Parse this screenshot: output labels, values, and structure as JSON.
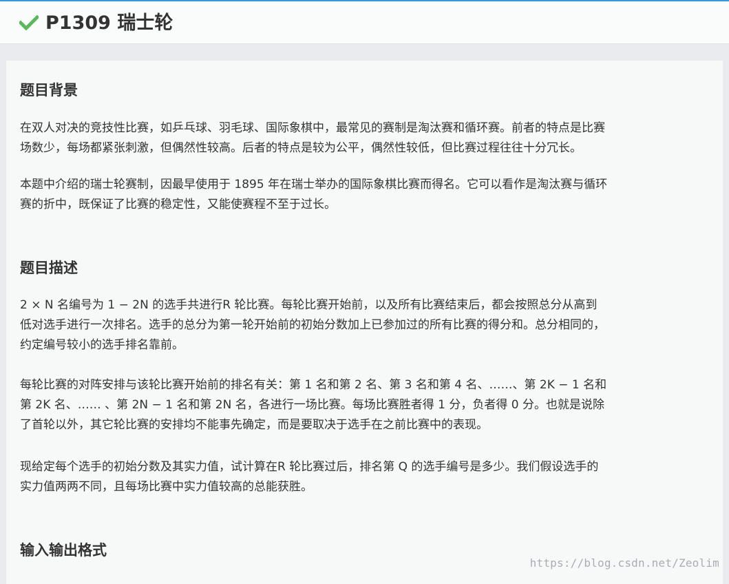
{
  "header": {
    "title": "P1309 瑞士轮",
    "status_icon": "check-icon",
    "status_color": "#5cb85c"
  },
  "sections": [
    {
      "title": "题目背景",
      "paragraphs": [
        {
          "lines": [
            "在双人对决的竞技性比赛，如乒乓球、羽毛球、国际象棋中，最常见的赛制是淘汰赛和循环赛。前者的特点是比赛",
            "场数少，每场都紧张刺激，但偶然性较高。后者的特点是较为公平，偶然性较低，但比赛过程往往十分冗长。"
          ]
        },
        {
          "lines": [
            "本题中介绍的瑞士轮赛制，因最早使用于 1895 年在瑞士举办的国际象棋比赛而得名。它可以看作是淘汰赛与循环",
            "赛的折中，既保证了比赛的稳定性，又能使赛程不至于过长。"
          ]
        }
      ]
    },
    {
      "title": "题目描述",
      "paragraphs": [
        {
          "lines": [
            "2 × N 名编号为 1 − 2N 的选手共进行R 轮比赛。每轮比赛开始前，以及所有比赛结束后，都会按照总分从高到",
            "低对选手进行一次排名。选手的总分为第一轮开始前的初始分数加上已参加过的所有比赛的得分和。总分相同的，",
            "约定编号较小的选手排名靠前。"
          ]
        },
        {
          "lines": [
            "每轮比赛的对阵安排与该轮比赛开始前的排名有关：第 1 名和第 2 名、第 3 名和第 4 名、……、第 2K − 1 名和",
            "第 2K 名、…… 、第 2N − 1 名和第 2N 名，各进行一场比赛。每场比赛胜者得 1 分，负者得 0 分。也就是说除",
            "了首轮以外，其它轮比赛的安排均不能事先确定，而是要取决于选手在之前比赛中的表现。"
          ]
        },
        {
          "lines": [
            "现给定每个选手的初始分数及其实力值，试计算在R 轮比赛过后，排名第 Q 的选手编号是多少。我们假设选手的",
            "实力值两两不同，且每场比赛中实力值较高的总能获胜。"
          ]
        }
      ]
    },
    {
      "title": "输入输出格式",
      "paragraphs": []
    }
  ],
  "watermark": "https://blog.csdn.net/Zeolim"
}
